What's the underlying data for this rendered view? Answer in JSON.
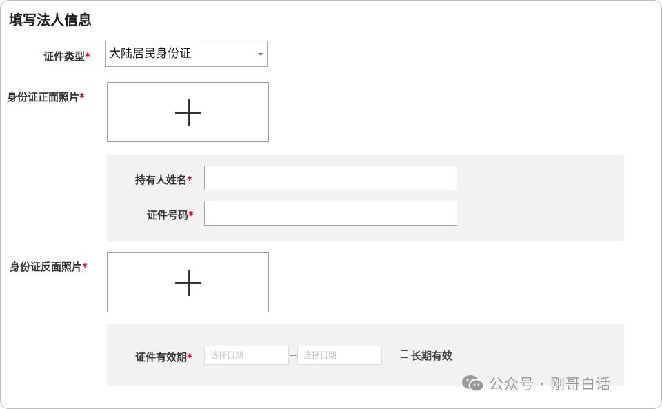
{
  "form": {
    "title": "填写法人信息",
    "required_mark": "*",
    "id_type": {
      "label": "证件类型",
      "selected": "大陆居民身份证"
    },
    "front_photo": {
      "label": "身份证正面照片"
    },
    "holder_name": {
      "label": "持有人姓名",
      "value": ""
    },
    "id_number": {
      "label": "证件号码",
      "value": ""
    },
    "back_photo": {
      "label": "身份证反面照片"
    },
    "validity": {
      "label": "证件有效期",
      "start_placeholder": "选择日期",
      "end_placeholder": "选择日期",
      "long_term_label": "长期有效",
      "long_term_checked": false
    }
  },
  "watermark": {
    "icon": "wechat-icon",
    "text": "公众号 · 刚哥白话"
  }
}
